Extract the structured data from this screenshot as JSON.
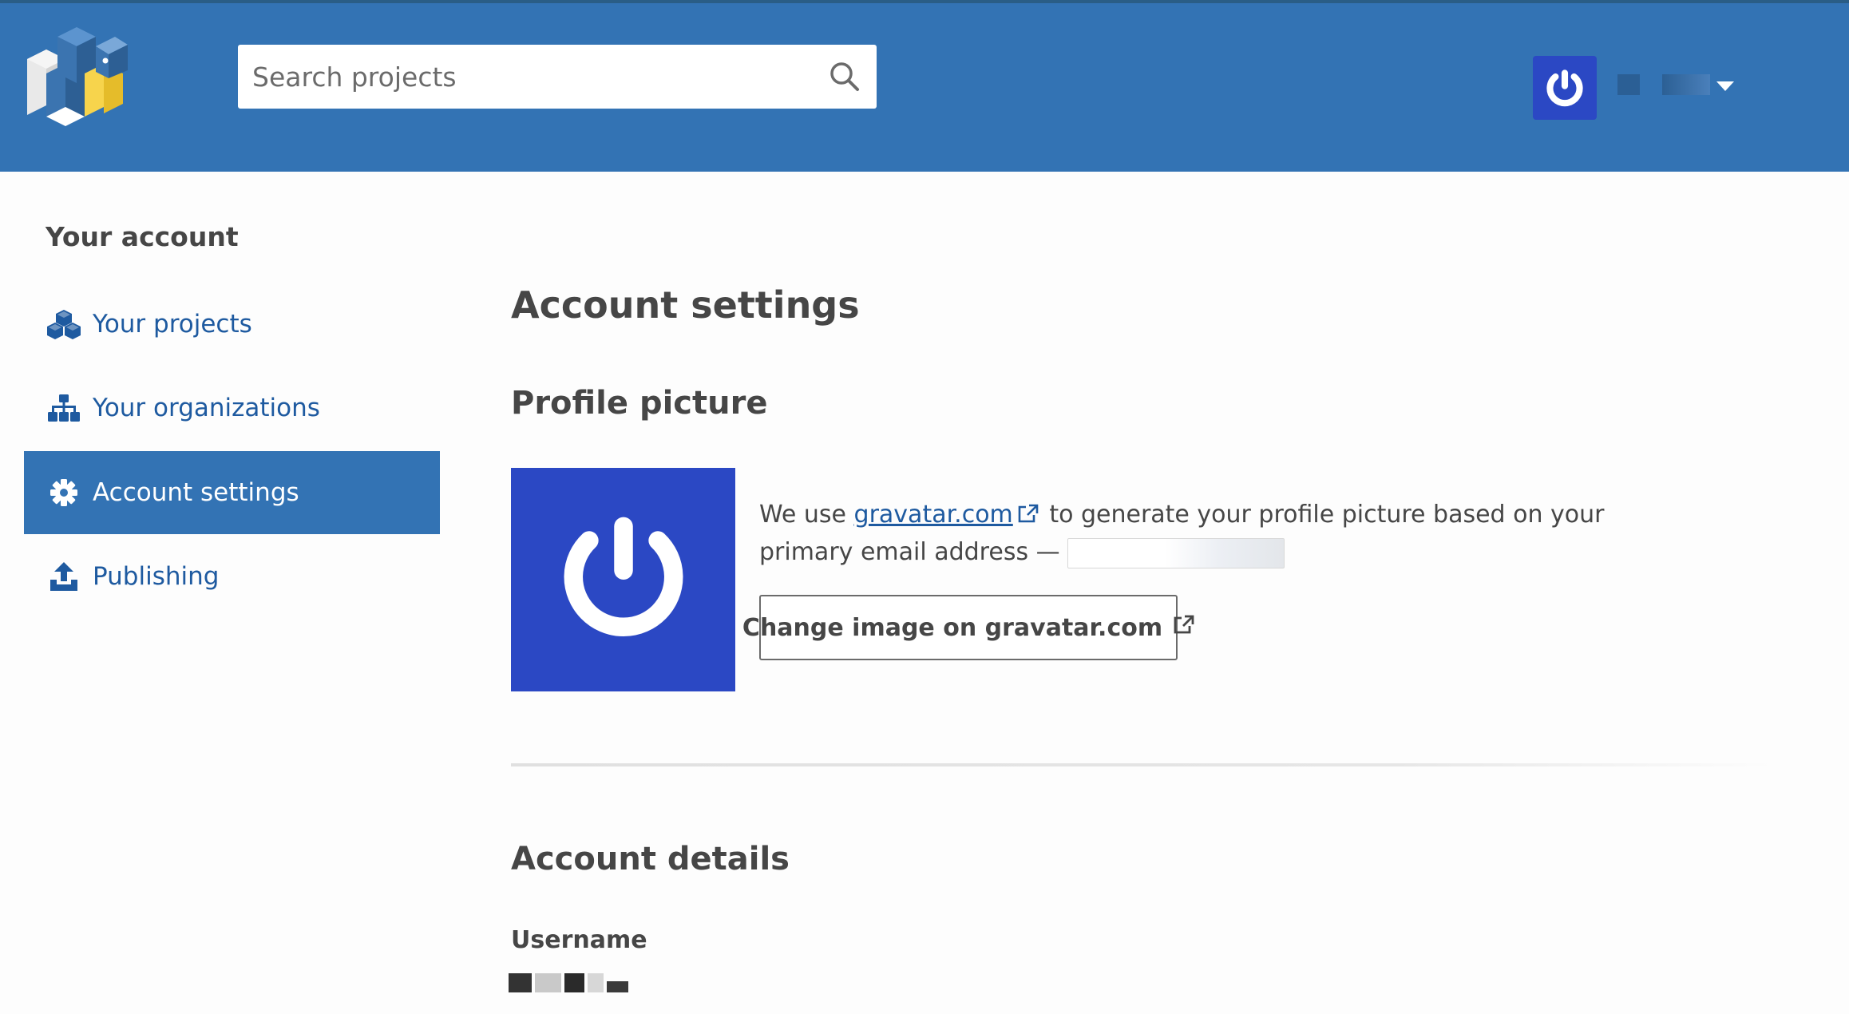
{
  "header": {
    "search": {
      "placeholder": "Search projects"
    },
    "user": {
      "name_visible": false
    }
  },
  "sidebar": {
    "title": "Your account",
    "items": [
      {
        "label": "Your projects",
        "icon": "cubes-icon",
        "active": false
      },
      {
        "label": "Your organizations",
        "icon": "sitemap-icon",
        "active": false
      },
      {
        "label": "Account settings",
        "icon": "gear-icon",
        "active": true
      },
      {
        "label": "Publishing",
        "icon": "upload-icon",
        "active": false
      }
    ]
  },
  "main": {
    "title": "Account settings",
    "profile": {
      "heading": "Profile picture",
      "text_before_link": "We use ",
      "link_label": "gravatar.com",
      "text_after_link": " to generate your profile picture based on your primary email address — ",
      "change_button": "Change image on gravatar.com"
    },
    "details": {
      "heading": "Account details",
      "username_label": "Username"
    }
  },
  "colors": {
    "header": "#3373b4",
    "link": "#1e5aa0",
    "avatar": "#2b48c4",
    "logo_blue": "#3b74b0",
    "logo_yellow": "#f7d44c"
  }
}
